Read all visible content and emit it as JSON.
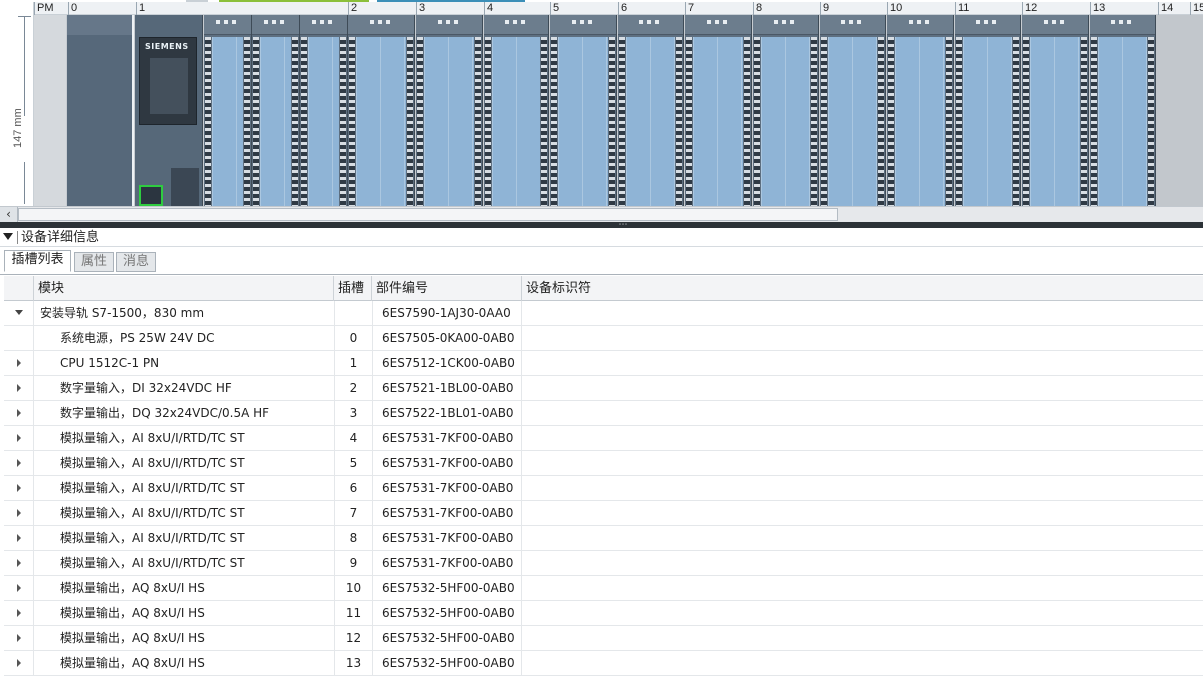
{
  "rack": {
    "ruler_label": "147 mm",
    "slots": [
      "PM",
      "0",
      "1",
      "2",
      "3",
      "4",
      "5",
      "6",
      "7",
      "8",
      "9",
      "10",
      "11",
      "12",
      "13",
      "14",
      "15"
    ],
    "cpu_brand": "SIEMENS"
  },
  "details": {
    "title": "设备详细信息",
    "tabs": [
      "插槽列表",
      "属性",
      "消息"
    ],
    "columns": [
      "模块",
      "插槽",
      "部件编号",
      "设备标识符"
    ],
    "rows": [
      {
        "module": "安装导轨 S7-1500，830 mm",
        "slot": "",
        "part": "6ES7590-1AJ30-0AA0",
        "expand": "down",
        "indent": false
      },
      {
        "module": "系统电源，PS 25W 24V DC",
        "slot": "0",
        "part": "6ES7505-0KA00-0AB0",
        "expand": "none",
        "indent": true
      },
      {
        "module": "CPU 1512C-1 PN",
        "slot": "1",
        "part": "6ES7512-1CK00-0AB0",
        "expand": "right",
        "indent": true
      },
      {
        "module": "数字量输入，DI 32x24VDC HF",
        "slot": "2",
        "part": "6ES7521-1BL00-0AB0",
        "expand": "right",
        "indent": true
      },
      {
        "module": "数字量输出，DQ 32x24VDC/0.5A HF",
        "slot": "3",
        "part": "6ES7522-1BL01-0AB0",
        "expand": "right",
        "indent": true
      },
      {
        "module": "模拟量输入，AI 8xU/I/RTD/TC ST",
        "slot": "4",
        "part": "6ES7531-7KF00-0AB0",
        "expand": "right",
        "indent": true
      },
      {
        "module": "模拟量输入，AI 8xU/I/RTD/TC ST",
        "slot": "5",
        "part": "6ES7531-7KF00-0AB0",
        "expand": "right",
        "indent": true
      },
      {
        "module": "模拟量输入，AI 8xU/I/RTD/TC ST",
        "slot": "6",
        "part": "6ES7531-7KF00-0AB0",
        "expand": "right",
        "indent": true
      },
      {
        "module": "模拟量输入，AI 8xU/I/RTD/TC ST",
        "slot": "7",
        "part": "6ES7531-7KF00-0AB0",
        "expand": "right",
        "indent": true
      },
      {
        "module": "模拟量输入，AI 8xU/I/RTD/TC ST",
        "slot": "8",
        "part": "6ES7531-7KF00-0AB0",
        "expand": "right",
        "indent": true
      },
      {
        "module": "模拟量输入，AI 8xU/I/RTD/TC ST",
        "slot": "9",
        "part": "6ES7531-7KF00-0AB0",
        "expand": "right",
        "indent": true
      },
      {
        "module": "模拟量输出，AQ 8xU/I HS",
        "slot": "10",
        "part": "6ES7532-5HF00-0AB0",
        "expand": "right",
        "indent": true
      },
      {
        "module": "模拟量输出，AQ 8xU/I HS",
        "slot": "11",
        "part": "6ES7532-5HF00-0AB0",
        "expand": "right",
        "indent": true
      },
      {
        "module": "模拟量输出，AQ 8xU/I HS",
        "slot": "12",
        "part": "6ES7532-5HF00-0AB0",
        "expand": "right",
        "indent": true
      },
      {
        "module": "模拟量输出，AQ 8xU/I HS",
        "slot": "13",
        "part": "6ES7532-5HF00-0AB0",
        "expand": "right",
        "indent": true
      }
    ]
  },
  "colors": {
    "module_body": "#8fb4d6",
    "module_frame": "#5e6f80",
    "port_highlight": "#2ecc40",
    "splitter": "#2c3237"
  }
}
